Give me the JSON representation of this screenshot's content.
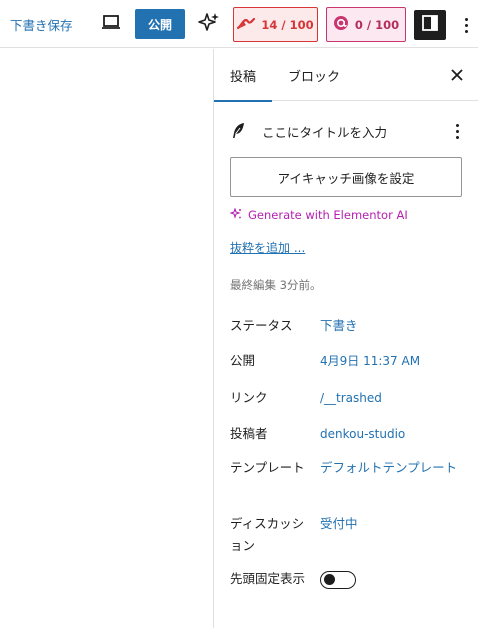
{
  "toolbar": {
    "save_draft_label": "下書き保存",
    "publish_label": "公開",
    "seo_score": "14 / 100",
    "readability_score": "0 / 100",
    "seo_score_color": "#d63638",
    "readability_score_color": "#c9356e",
    "icons": [
      "desktop-preview-icon",
      "sparkle-icon",
      "seo-score-icon",
      "readability-score-icon",
      "sidebar-toggle-icon",
      "more-vertical-icon"
    ]
  },
  "sidebar": {
    "tabs": [
      {
        "label": "投稿",
        "active": true
      },
      {
        "label": "ブロック",
        "active": false
      }
    ],
    "title_placeholder": "ここにタイトルを入力",
    "featured_image_label": "アイキャッチ画像を設定",
    "elementor_ai_label": "Generate with Elementor AI",
    "excerpt_label": "抜粋を追加 ...",
    "last_edited": "最終編集 3分前。",
    "meta": [
      {
        "label": "ステータス",
        "value": "下書き"
      },
      {
        "label": "公開",
        "value": "4月9日 11:37 AM"
      },
      {
        "label": "リンク",
        "value": "/__trashed"
      },
      {
        "label": "投稿者",
        "value": "denkou-studio"
      },
      {
        "label": "テンプレート",
        "value": "デフォルトテンプレート"
      },
      {
        "label": "ディスカッション",
        "value": "受付中"
      },
      {
        "label": "先頭固定表示",
        "value": ""
      }
    ],
    "sticky_enabled": false,
    "accent_color": "#2271b1"
  }
}
